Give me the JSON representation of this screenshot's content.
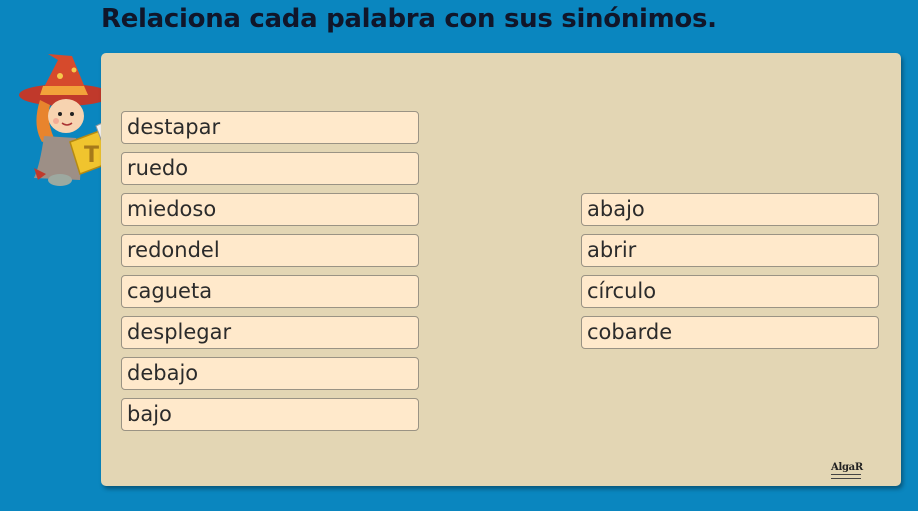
{
  "header": {
    "title": "Relaciona cada palabra con sus sinónimos."
  },
  "left_words": [
    "destapar",
    "ruedo",
    "miedoso",
    "redondel",
    "cagueta",
    "desplegar",
    "debajo",
    "bajo"
  ],
  "right_words": [
    "abajo",
    "abrir",
    "círculo",
    "cobarde"
  ],
  "footer": {
    "logo_text": "AlgaR"
  },
  "colors": {
    "background": "#0a86bf",
    "panel": "#e3d6b4",
    "word_box": "#ffe9cb"
  },
  "icons": {
    "mascot": "witch-reading-book-icon"
  }
}
